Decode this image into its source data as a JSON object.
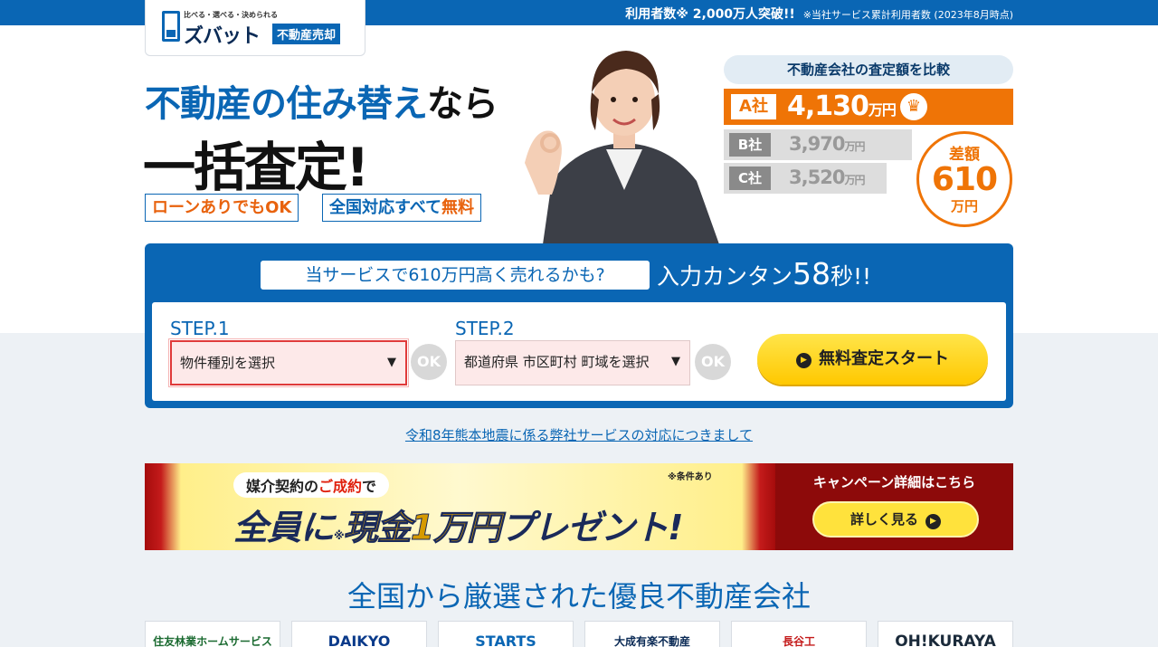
{
  "topbar": {
    "users_text": "利用者数※ 2,000万人突破!!",
    "users_note": "※当社サービス累計利用者数 (2023年8月時点)"
  },
  "logo": {
    "tagline": "比べる・選べる・決められる",
    "name": "ズバット",
    "badge": "不動産売却"
  },
  "hero": {
    "title1_blue": "不動産の住み替え",
    "title1_black": "なら",
    "title2": "一括査定!",
    "tag1": "ローンありでもOK",
    "tag2_main": "全国対応すべて",
    "tag2_accent": "無料"
  },
  "comparison": {
    "title": "不動産会社の査定額を比較",
    "rows": [
      {
        "label": "A社",
        "value": "4,130",
        "unit": "万円"
      },
      {
        "label": "B社",
        "value": "3,970",
        "unit": "万円"
      },
      {
        "label": "C社",
        "value": "3,520",
        "unit": "万円"
      }
    ],
    "diff_label": "差額",
    "diff_value": "610",
    "diff_unit": "万円"
  },
  "form": {
    "pill": "当サービスで610万円高く売れるかも?",
    "headline_pre": "入力カンタン",
    "headline_num": "58",
    "headline_post": "秒!!",
    "step1_label": "STEP.1",
    "step1_select": "物件種別を選択",
    "step2_label": "STEP.2",
    "step2_select": "都道府県 市区町村 町域を選択",
    "ok_label": "OK",
    "start_button": "無料査定スタート"
  },
  "notice_link": "令和8年熊本地震に係る弊社サービスの対応につきまして",
  "campaign": {
    "sub_pre": "媒介契約の",
    "sub_em": "ご成約",
    "sub_post": "で",
    "note": "※条件あり",
    "main_pre": "全員に",
    "main_mark": "※",
    "main_gold": "現金1万円",
    "main_post": "プレゼント!",
    "right_title": "キャンペーン詳細はこちら",
    "button": "詳しく見る"
  },
  "section_title": "全国から厳選された優良不動産会社",
  "companies": [
    "住友林業ホームサービス",
    "DAIKYO",
    "STARTS",
    "大成有楽不動産",
    "長谷工",
    "OH!KURAYA"
  ],
  "colors": {
    "brand_blue": "#0a66b4",
    "accent_orange": "#ef7406",
    "button_yellow": "#ffd21a"
  }
}
